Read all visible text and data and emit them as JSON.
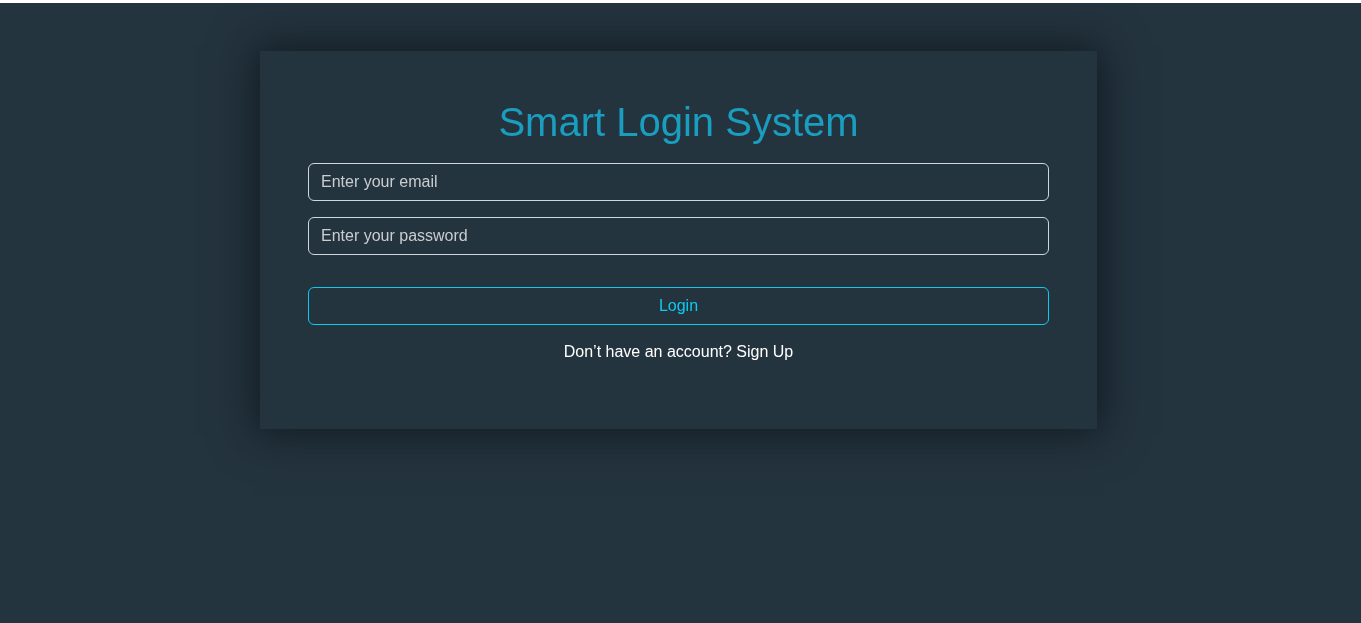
{
  "login_card": {
    "title": "Smart Login System",
    "fields": [
      {
        "placeholder": "Enter your email"
      },
      {
        "placeholder": "Enter your password"
      }
    ],
    "button": "Login",
    "signup": {
      "text": "Don’t have an account?",
      "link": "Sign Up"
    }
  }
}
